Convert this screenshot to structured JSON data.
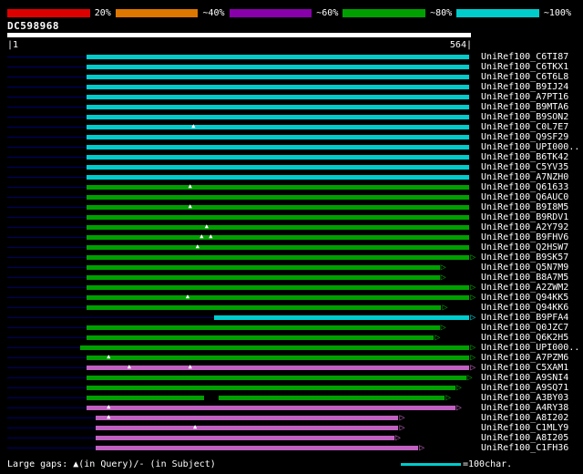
{
  "query": {
    "name": "DC598968",
    "length": 564
  },
  "ruler": {
    "left": "|1",
    "right": "564|"
  },
  "legend": {
    "gaps_text": "Large gaps: ▲(in Query)/- (in Subject)",
    "unit_label": "=100char.",
    "unit_color": "#00cccc"
  },
  "colors": {
    "cyan": "#00cccc",
    "green": "#00a000",
    "magenta": "#c060c0",
    "faint_line": "#000066"
  },
  "chart_data": {
    "type": "bar",
    "subtype": "blast-alignment-graphical-overview",
    "title": "DC598968",
    "query": {
      "name": "DC598968",
      "start": 1,
      "end": 564
    },
    "x_axis": {
      "min": 1,
      "max": 564,
      "left_tick": "|1",
      "right_tick": "564|"
    },
    "identity_scale": [
      {
        "label": "20%",
        "hex": "#dd0000",
        "band": "red"
      },
      {
        "label": "~40%",
        "hex": "#dd7700",
        "band": "orange"
      },
      {
        "label": "~60%",
        "hex": "#8800aa",
        "band": "purple"
      },
      {
        "label": "~80%",
        "hex": "#00a000",
        "band": "green"
      },
      {
        "label": "~100%",
        "hex": "#00cccc",
        "band": "cyan"
      }
    ],
    "hits": [
      {
        "label": "UniRef100_C6TI87",
        "color": "cyan",
        "start": 97,
        "end": 562,
        "arrow": false,
        "gap_marks": []
      },
      {
        "label": "UniRef100_C6TKX1",
        "color": "cyan",
        "start": 97,
        "end": 562,
        "arrow": false,
        "gap_marks": []
      },
      {
        "label": "UniRef100_C6T6L8",
        "color": "cyan",
        "start": 97,
        "end": 562,
        "arrow": false,
        "gap_marks": []
      },
      {
        "label": "UniRef100_B9IJ24",
        "color": "cyan",
        "start": 97,
        "end": 562,
        "arrow": false,
        "gap_marks": []
      },
      {
        "label": "UniRef100_A7PT16",
        "color": "cyan",
        "start": 97,
        "end": 562,
        "arrow": false,
        "gap_marks": []
      },
      {
        "label": "UniRef100_B9MTA6",
        "color": "cyan",
        "start": 97,
        "end": 562,
        "arrow": false,
        "gap_marks": []
      },
      {
        "label": "UniRef100_B9SON2",
        "color": "cyan",
        "start": 97,
        "end": 562,
        "arrow": false,
        "gap_marks": []
      },
      {
        "label": "UniRef100_C0L7E7",
        "color": "cyan",
        "start": 97,
        "end": 562,
        "arrow": false,
        "gap_marks": [
          228
        ]
      },
      {
        "label": "UniRef100_Q9SF29",
        "color": "cyan",
        "start": 97,
        "end": 562,
        "arrow": false,
        "gap_marks": []
      },
      {
        "label": "UniRef100_UPI000..",
        "color": "cyan",
        "start": 97,
        "end": 562,
        "arrow": false,
        "gap_marks": []
      },
      {
        "label": "UniRef100_B6TK42",
        "color": "cyan",
        "start": 97,
        "end": 562,
        "arrow": false,
        "gap_marks": []
      },
      {
        "label": "UniRef100_C5YV35",
        "color": "cyan",
        "start": 97,
        "end": 562,
        "arrow": false,
        "gap_marks": []
      },
      {
        "label": "UniRef100_A7NZH0",
        "color": "cyan",
        "start": 97,
        "end": 562,
        "arrow": false,
        "gap_marks": []
      },
      {
        "label": "UniRef100_Q61633",
        "color": "green",
        "start": 97,
        "end": 562,
        "arrow": false,
        "gap_marks": [
          224
        ]
      },
      {
        "label": "UniRef100_Q6AUC0",
        "color": "green",
        "start": 97,
        "end": 562,
        "arrow": false,
        "gap_marks": []
      },
      {
        "label": "UniRef100_B9I8M5",
        "color": "green",
        "start": 97,
        "end": 562,
        "arrow": false,
        "gap_marks": [
          224
        ]
      },
      {
        "label": "UniRef100_B9RDV1",
        "color": "green",
        "start": 97,
        "end": 562,
        "arrow": false,
        "gap_marks": []
      },
      {
        "label": "UniRef100_A2Y792",
        "color": "green",
        "start": 97,
        "end": 562,
        "arrow": false,
        "gap_marks": [
          244
        ]
      },
      {
        "label": "UniRef100_B9FHV6",
        "color": "green",
        "start": 97,
        "end": 562,
        "arrow": false,
        "gap_marks": [
          238,
          249
        ]
      },
      {
        "label": "UniRef100_Q2HSW7",
        "color": "green",
        "start": 97,
        "end": 562,
        "arrow": false,
        "gap_marks": [
          233
        ]
      },
      {
        "label": "UniRef100_B9SK57",
        "color": "green",
        "start": 97,
        "end": 562,
        "arrow": true,
        "gap_marks": []
      },
      {
        "label": "UniRef100_Q5N7M9",
        "color": "green",
        "start": 97,
        "end": 526,
        "arrow": true,
        "gap_marks": []
      },
      {
        "label": "UniRef100_B8A7M5",
        "color": "green",
        "start": 97,
        "end": 526,
        "arrow": true,
        "gap_marks": []
      },
      {
        "label": "UniRef100_A2ZWM2",
        "color": "green",
        "start": 97,
        "end": 562,
        "arrow": true,
        "gap_marks": []
      },
      {
        "label": "UniRef100_Q94KK5",
        "color": "green",
        "start": 97,
        "end": 562,
        "arrow": true,
        "gap_marks": [
          221
        ]
      },
      {
        "label": "UniRef100_Q94KK6",
        "color": "green",
        "start": 97,
        "end": 528,
        "arrow": true,
        "gap_marks": []
      },
      {
        "label": "UniRef100_B9PFA4",
        "color": "cyan",
        "start": 252,
        "end": 562,
        "arrow": true,
        "gap_marks": []
      },
      {
        "label": "UniRef100_Q0JZC7",
        "color": "green",
        "start": 97,
        "end": 526,
        "arrow": true,
        "gap_marks": []
      },
      {
        "label": "UniRef100_Q6K2H5",
        "color": "green",
        "start": 97,
        "end": 519,
        "arrow": true,
        "gap_marks": []
      },
      {
        "label": "UniRef100_UPI000..",
        "color": "green",
        "start": 90,
        "end": 562,
        "arrow": true,
        "gap_marks": []
      },
      {
        "label": "UniRef100_A7PZM6",
        "color": "green",
        "start": 97,
        "end": 562,
        "arrow": true,
        "gap_marks": [
          125
        ]
      },
      {
        "label": "UniRef100_C5XAM1",
        "color": "magenta",
        "start": 97,
        "end": 562,
        "arrow": true,
        "gap_marks": [
          150,
          224
        ]
      },
      {
        "label": "UniRef100_A9SNI4",
        "color": "green",
        "start": 97,
        "end": 558,
        "arrow": true,
        "gap_marks": []
      },
      {
        "label": "UniRef100_A9SQ71",
        "color": "green",
        "start": 97,
        "end": 545,
        "arrow": true,
        "gap_marks": []
      },
      {
        "label": "UniRef100_A3BY03",
        "color": "green",
        "start": 97,
        "end": 532,
        "arrow": true,
        "gap_marks": [],
        "segments": [
          [
            97,
            240
          ],
          [
            258,
            532
          ]
        ]
      },
      {
        "label": "UniRef100_A4RY38",
        "color": "magenta",
        "start": 97,
        "end": 545,
        "arrow": true,
        "gap_marks": [
          125
        ]
      },
      {
        "label": "UniRef100_A8I202",
        "color": "magenta",
        "start": 108,
        "end": 476,
        "arrow": true,
        "gap_marks": [
          125
        ]
      },
      {
        "label": "UniRef100_C1MLY9",
        "color": "magenta",
        "start": 108,
        "end": 476,
        "arrow": true,
        "gap_marks": [
          230
        ]
      },
      {
        "label": "UniRef100_A8I205",
        "color": "magenta",
        "start": 108,
        "end": 471,
        "arrow": true,
        "gap_marks": []
      },
      {
        "label": "UniRef100_C1FH36",
        "color": "magenta",
        "start": 108,
        "end": 500,
        "arrow": true,
        "gap_marks": []
      }
    ]
  }
}
